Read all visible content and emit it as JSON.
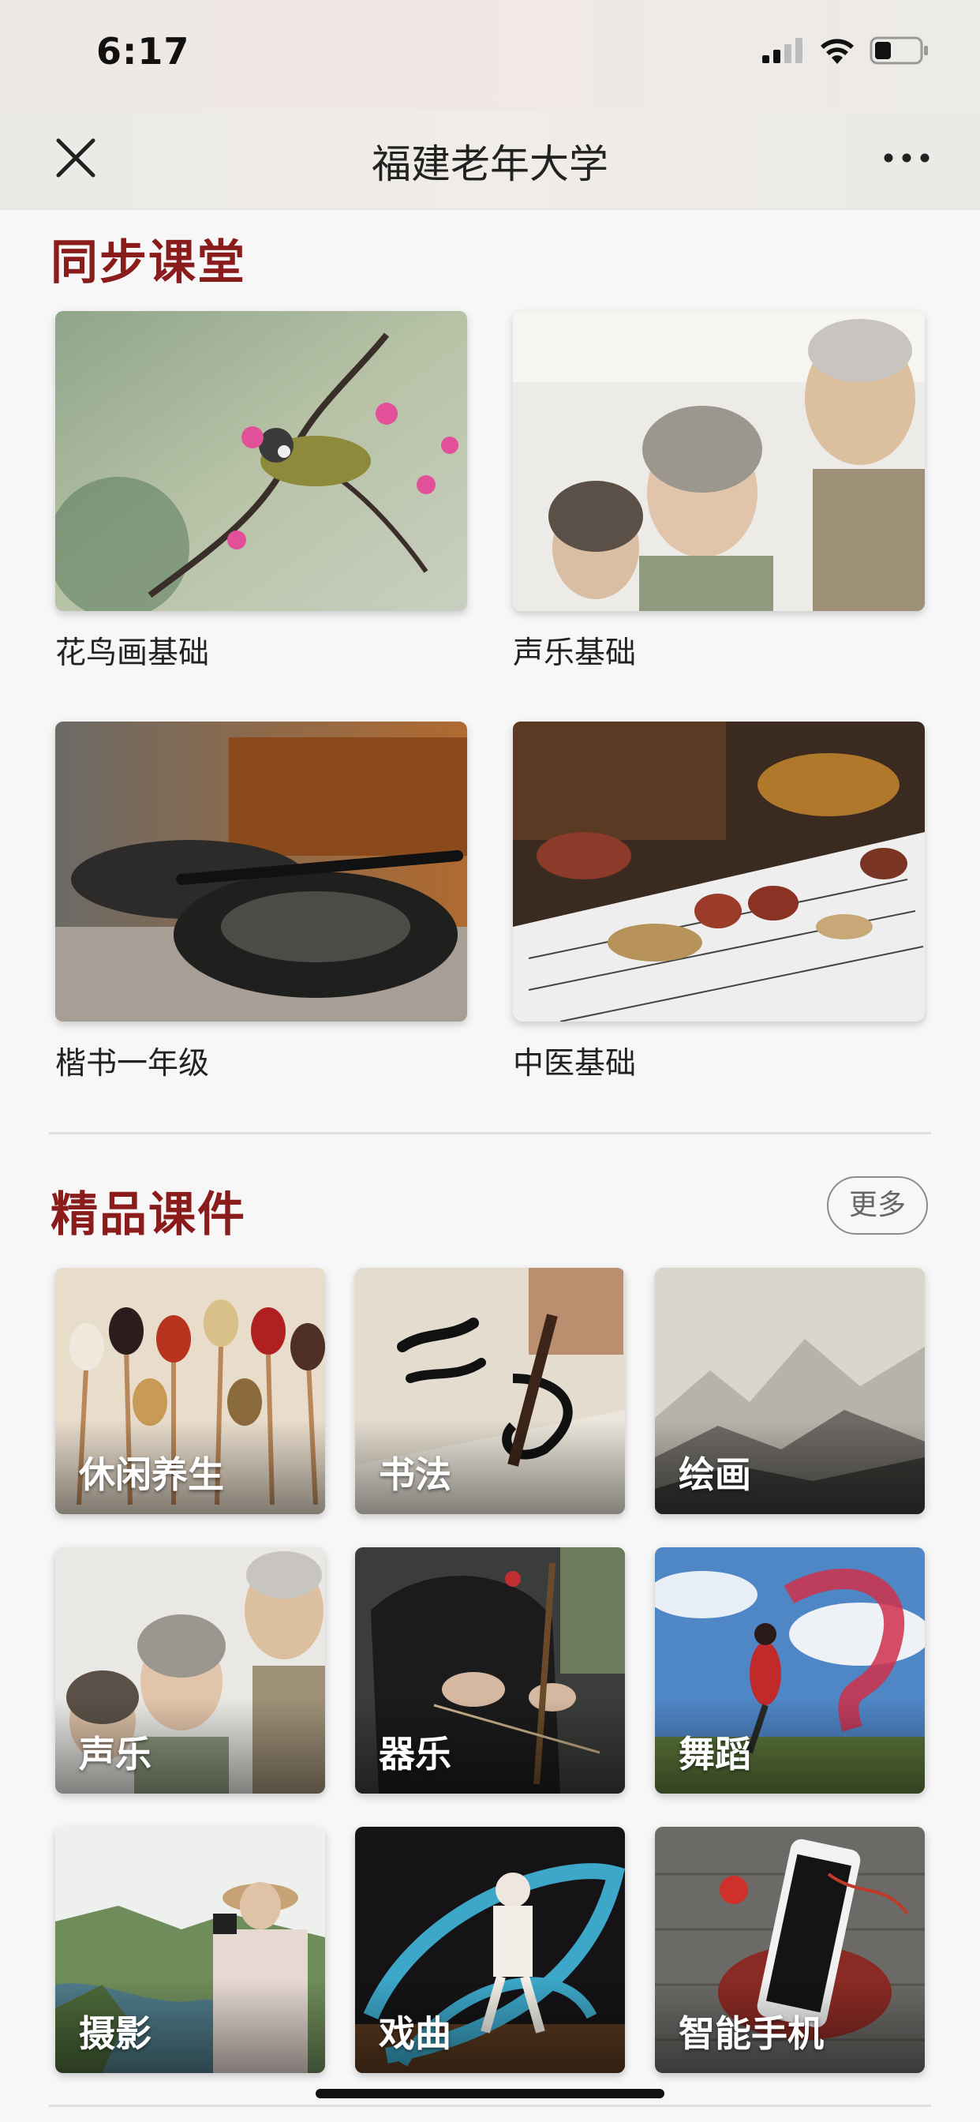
{
  "status": {
    "time": "6:17"
  },
  "nav": {
    "title": "福建老年大学",
    "close_icon": "close-icon",
    "more_icon": "more-icon"
  },
  "sync": {
    "title": "同步课堂",
    "courses": [
      {
        "label": "花鸟画基础",
        "image": "bird-on-blossom-branch"
      },
      {
        "label": "声乐基础",
        "image": "seniors-singing"
      },
      {
        "label": "楷书一年级",
        "image": "ink-stone-brush"
      },
      {
        "label": "中医基础",
        "image": "herbal-medicine"
      }
    ]
  },
  "premium": {
    "title": "精品课件",
    "more_label": "更多",
    "tiles": [
      {
        "label": "休闲养生",
        "image": "grain-spoons"
      },
      {
        "label": "书法",
        "image": "calligraphy-brush"
      },
      {
        "label": "绘画",
        "image": "ink-landscape"
      },
      {
        "label": "声乐",
        "image": "seniors-singing"
      },
      {
        "label": "器乐",
        "image": "erhu-player"
      },
      {
        "label": "舞蹈",
        "image": "dancer-red-scarf"
      },
      {
        "label": "摄影",
        "image": "photographer-lake"
      },
      {
        "label": "戏曲",
        "image": "opera-performer"
      },
      {
        "label": "智能手机",
        "image": "smartphone"
      }
    ]
  },
  "colors": {
    "accent": "#8a1c1c",
    "background": "#f7f7f7"
  }
}
